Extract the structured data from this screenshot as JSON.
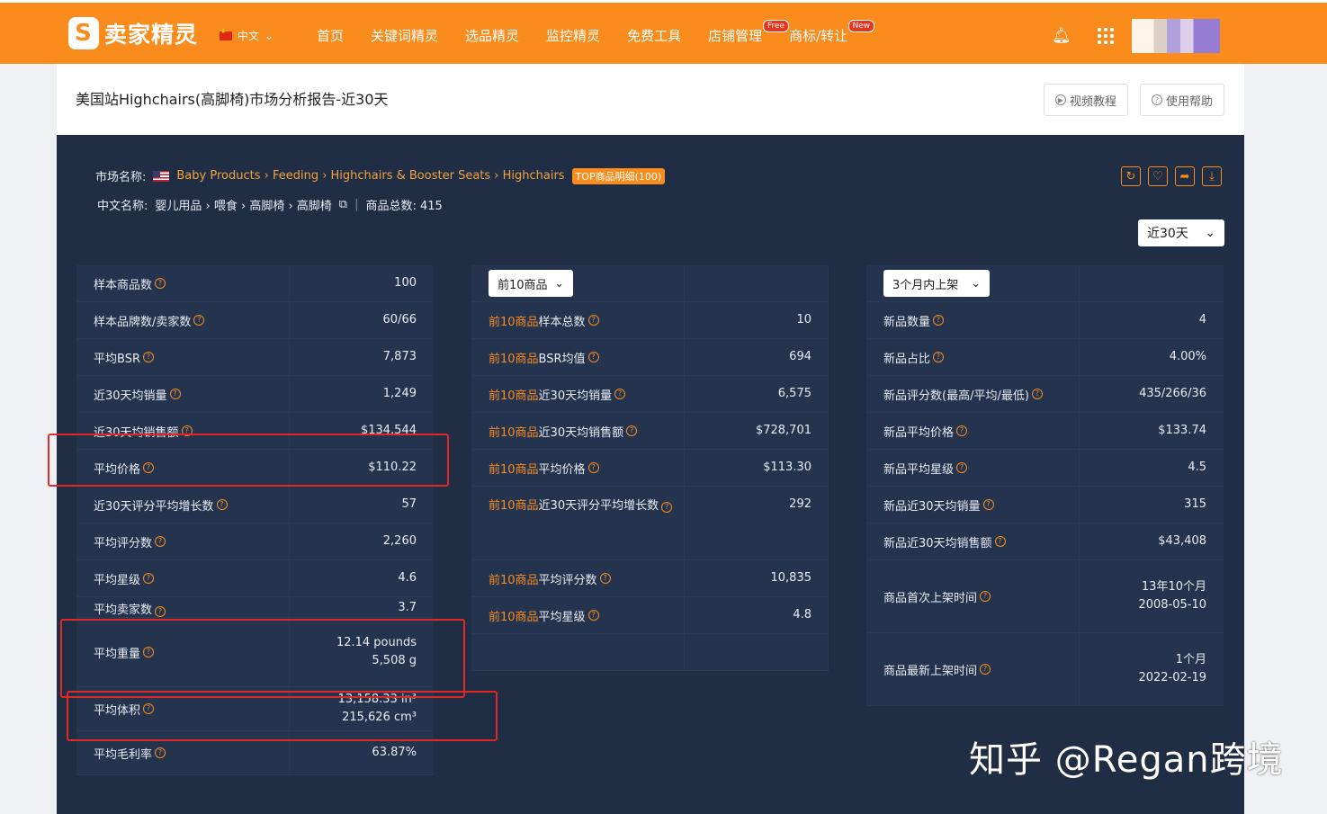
{
  "app": {
    "logo_text": "卖家精灵",
    "lang": "中文",
    "nav": [
      {
        "label": "首页"
      },
      {
        "label": "关键词精灵"
      },
      {
        "label": "选品精灵"
      },
      {
        "label": "监控精灵"
      },
      {
        "label": "免费工具"
      },
      {
        "label": "店铺管理",
        "badge": "Free"
      },
      {
        "label": "商标/转让",
        "badge": "New"
      }
    ]
  },
  "header": {
    "title": "美国站Highchairs(高脚椅)市场分析报告-近30天",
    "video_btn": "视频教程",
    "help_btn": "使用帮助"
  },
  "market": {
    "name_label": "市场名称:",
    "crumbs": "Baby Products › Feeding › Highchairs & Booster Seats › Highchairs",
    "top_badge": "TOP商品明细(100)",
    "cn_label": "中文名称:",
    "cn_crumbs": "婴儿用品 › 喂食 › 高脚椅 › 高脚椅",
    "total_label": "商品总数: 415",
    "period": "近30天"
  },
  "table1": [
    {
      "label": "样本商品数",
      "value": "100"
    },
    {
      "label": "样本品牌数/卖家数",
      "value": "60/66"
    },
    {
      "label": "平均BSR",
      "value": "7,873"
    },
    {
      "label": "近30天均销量",
      "value": "1,249"
    },
    {
      "label": "近30天均销售额",
      "value": "$134,544"
    },
    {
      "label": "平均价格",
      "value": "$110.22"
    },
    {
      "label": "近30天评分平均增长数",
      "value": "57"
    },
    {
      "label": "平均评分数",
      "value": "2,260"
    },
    {
      "label": "平均星级",
      "value": "4.6"
    },
    {
      "label": "平均卖家数",
      "value": "3.7"
    },
    {
      "label": "平均重量",
      "value": "12.14 pounds",
      "value2": "5,508 g"
    },
    {
      "label": "平均体积",
      "value": "13,158.33 in³",
      "value2": "215,626 cm³"
    },
    {
      "label": "平均毛利率",
      "value": "63.87%"
    }
  ],
  "table2": {
    "select": "前10商品",
    "prefix": "前10商品",
    "rows": [
      {
        "label": "样本总数",
        "value": "10"
      },
      {
        "label": "BSR均值",
        "value": "694"
      },
      {
        "label": "近30天均销量",
        "value": "6,575"
      },
      {
        "label": "近30天均销售额",
        "value": "$728,701"
      },
      {
        "label": "平均价格",
        "value": "$113.30"
      },
      {
        "label": "近30天评分平均增长数",
        "value": "292"
      },
      {
        "label": "平均评分数",
        "value": "10,835"
      },
      {
        "label": "平均星级",
        "value": "4.8"
      }
    ]
  },
  "table3": {
    "select": "3个月内上架",
    "rows": [
      {
        "label": "新品数量",
        "value": "4"
      },
      {
        "label": "新品占比",
        "value": "4.00%"
      },
      {
        "label": "新品评分数(最高/平均/最低)",
        "value": "435/266/36"
      },
      {
        "label": "新品平均价格",
        "value": "$133.74"
      },
      {
        "label": "新品平均星级",
        "value": "4.5"
      },
      {
        "label": "新品近30天均销量",
        "value": "315"
      },
      {
        "label": "新品近30天均销售额",
        "value": "$43,408"
      },
      {
        "label": "商品首次上架时间",
        "value": "13年10个月",
        "value2": "2008-05-10"
      },
      {
        "label": "商品最新上架时间",
        "value": "1个月",
        "value2": "2022-02-19"
      }
    ]
  },
  "watermark": "知乎 @Regan跨境"
}
